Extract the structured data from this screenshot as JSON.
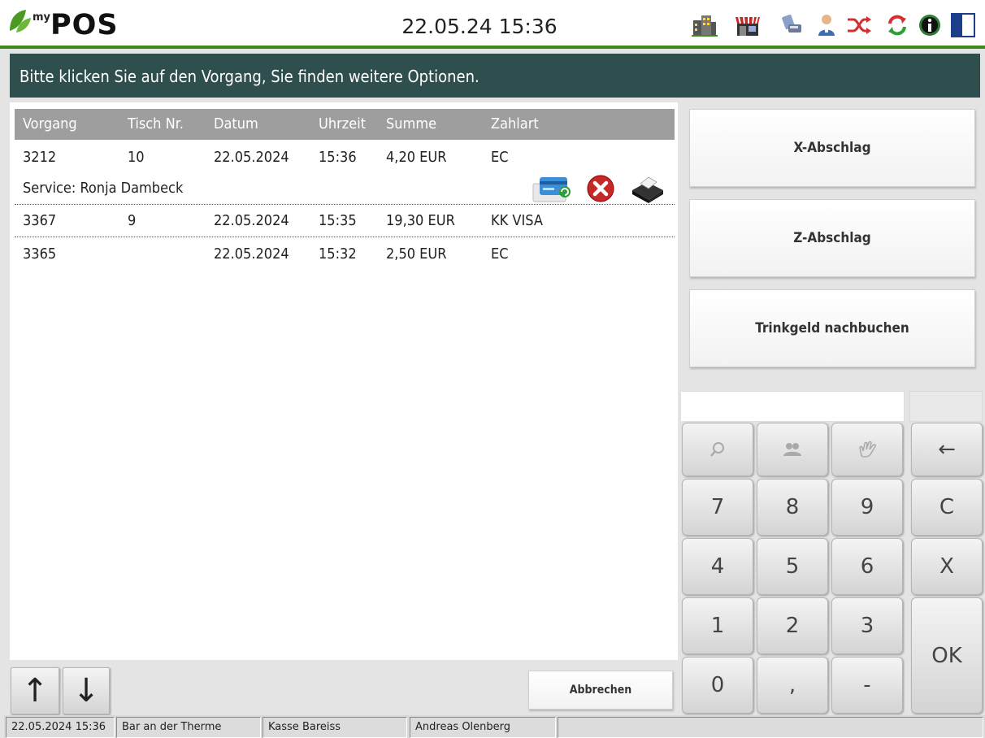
{
  "header": {
    "logo_my": "my",
    "logo_pos": "POS",
    "datetime": "22.05.24  15:36",
    "icons": [
      "building-icon",
      "store-icon",
      "terminal-icon",
      "user-icon",
      "shuffle-icon",
      "refresh-icon",
      "info-icon",
      "panel-icon"
    ]
  },
  "banner": {
    "text": "Bitte klicken Sie auf den Vorgang, Sie finden weitere Optionen."
  },
  "table": {
    "columns": [
      "Vorgang",
      "Tisch Nr.",
      "Datum",
      "Uhrzeit",
      "Summe",
      "Zahlart"
    ],
    "rows": [
      {
        "vorgang": "3212",
        "tisch": "10",
        "datum": "22.05.2024",
        "uhrzeit": "15:36",
        "summe": "4,20 EUR",
        "zahlart": "EC",
        "service": "Service: Ronja Dambeck"
      },
      {
        "vorgang": "3367",
        "tisch": "9",
        "datum": "22.05.2024",
        "uhrzeit": "15:35",
        "summe": "19,30 EUR",
        "zahlart": "KK VISA"
      },
      {
        "vorgang": "3365",
        "tisch": "",
        "datum": "22.05.2024",
        "uhrzeit": "15:32",
        "summe": "2,50 EUR",
        "zahlart": "EC"
      }
    ]
  },
  "actions": {
    "x_abschlag": "X-Abschlag",
    "z_abschlag": "Z-Abschlag",
    "trinkgeld": "Trinkgeld nachbuchen"
  },
  "footer_nav": {
    "up": "↑",
    "down": "↓",
    "cancel": "Abbrechen"
  },
  "keypad": {
    "input_value": "",
    "keys": {
      "k7": "7",
      "k8": "8",
      "k9": "9",
      "clear": "C",
      "k4": "4",
      "k5": "5",
      "k6": "6",
      "x": "X",
      "k1": "1",
      "k2": "2",
      "k3": "3",
      "ok": "OK",
      "k0": "0",
      "comma": ",",
      "minus": "-",
      "backspace": "←"
    }
  },
  "statusbar": {
    "datetime": "22.05.2024 15:36",
    "location": "Bar an der Therme",
    "register": "Kasse Bareiss",
    "user": "Andreas Olenberg",
    "extra": ""
  },
  "colors": {
    "brand_green": "#3d8a1e",
    "banner_bg": "#2f4f4f",
    "header_row_bg": "#9e9e9e"
  }
}
